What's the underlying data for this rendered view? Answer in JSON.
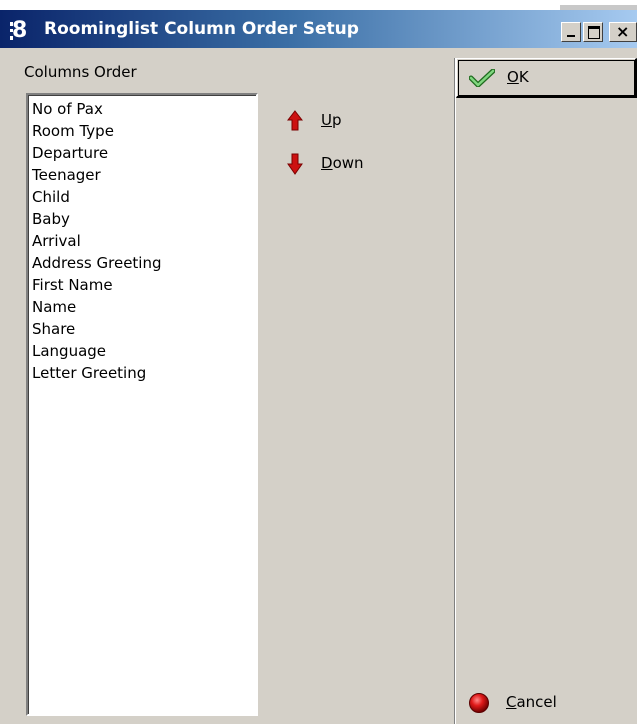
{
  "window": {
    "title": "Roominglist Column Order Setup",
    "app_icon_glyph": "8"
  },
  "caption_buttons": {
    "close_glyph": "×"
  },
  "columns_order": {
    "label": "Columns Order",
    "items": [
      "No of Pax",
      "Room Type",
      "Departure",
      "Teenager",
      "Child",
      "Baby",
      "Arrival",
      "Address Greeting",
      "First Name",
      "Name",
      "Share",
      "Language",
      "Letter Greeting"
    ]
  },
  "actions": {
    "up": {
      "accel": "U",
      "rest": "p"
    },
    "down": {
      "accel": "D",
      "rest": "own"
    },
    "ok": {
      "accel": "O",
      "rest": "K"
    },
    "cancel": {
      "accel": "C",
      "rest": "ancel"
    }
  },
  "icons": {
    "up": "arrow-up-icon",
    "down": "arrow-down-icon",
    "ok": "checkmark-icon",
    "cancel": "red-dot-icon"
  },
  "colors": {
    "dialog_bg": "#d4d0c8",
    "title_start": "#0a246a",
    "title_end": "#a6caf0",
    "arrow_red": "#cc1111",
    "check_green": "#3aa53a"
  }
}
